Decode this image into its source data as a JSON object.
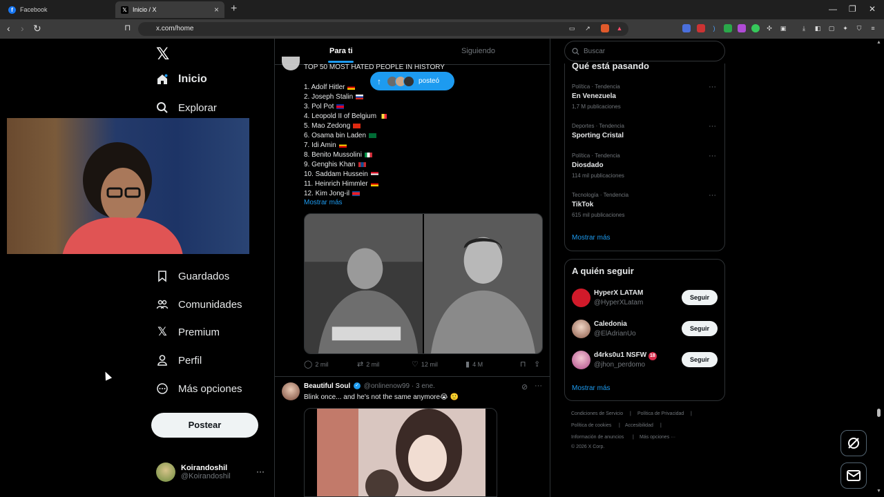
{
  "browser": {
    "tabs": [
      {
        "title": "Facebook",
        "active": false
      },
      {
        "title": "Inicio / X",
        "active": true
      }
    ],
    "url": "x.com/home"
  },
  "nav": {
    "home": "Inicio",
    "explore": "Explorar",
    "bookmarks": "Guardados",
    "communities": "Comunidades",
    "premium": "Premium",
    "profile": "Perfil",
    "more": "Más opciones",
    "post_button": "Postear"
  },
  "account": {
    "name": "Koirandoshil",
    "handle": "@Koirandoshil"
  },
  "feed": {
    "tabs": [
      "Para ti",
      "Siguiendo"
    ],
    "posted_pill": "posteó",
    "tweet1": {
      "title": "TOP 50 MOST HATED PEOPLE IN HISTORY",
      "items": [
        "1. Adolf Hitler",
        "2. Joseph Stalin",
        "3. Pol Pot",
        "4. Leopold II of Belgium",
        "5. Mao Zedong",
        "6. Osama bin Laden",
        "7. Idi Amin",
        "8. Benito Mussolini",
        "9. Genghis Khan",
        "10. Saddam Hussein",
        "11. Heinrich Himmler",
        "12. Kim Jong-il"
      ],
      "show_more": "Mostrar más",
      "replies": "2 mil",
      "reposts": "2 mil",
      "likes": "12 mil",
      "views": "4 M"
    },
    "tweet2": {
      "name": "Beautiful Soul",
      "handle": "@onlinenow99",
      "date": "· 3 ene.",
      "text": "Blink once... and he's not the same anymore😭 🙂"
    }
  },
  "search": {
    "placeholder": "Buscar"
  },
  "trends": {
    "title": "Qué está pasando",
    "items": [
      {
        "category": "Política · Tendencia",
        "name": "En Venezuela",
        "count": "1,7 M publicaciones"
      },
      {
        "category": "Deportes · Tendencia",
        "name": "Sporting Cristal",
        "count": ""
      },
      {
        "category": "Política · Tendencia",
        "name": "Diosdado",
        "count": "114 mil publicaciones"
      },
      {
        "category": "Tecnología · Tendencia",
        "name": "TikTok",
        "count": "615 mil publicaciones"
      }
    ],
    "show_more": "Mostrar más"
  },
  "who_to_follow": {
    "title": "A quién seguir",
    "items": [
      {
        "name": "HyperX LATAM",
        "handle": "@HyperXLatam",
        "button": "Seguir"
      },
      {
        "name": "Caledonia",
        "handle": "@ElAdrianUo",
        "button": "Seguir"
      },
      {
        "name": "d4rks0u1 NSFW",
        "handle": "@jhon_perdomo",
        "button": "Seguir"
      }
    ],
    "show_more": "Mostrar más"
  },
  "footer": {
    "terms": "Condiciones de Servicio",
    "privacy": "Política de Privacidad",
    "cookies": "Política de cookies",
    "accessibility": "Accesibilidad",
    "ads": "Información de anuncios",
    "more": "Más opciones ···",
    "copyright": "© 2026 X Corp."
  },
  "colors": {
    "accent": "#1d9bf0",
    "background": "#000000",
    "border": "#2f3336",
    "muted": "#71767b"
  }
}
